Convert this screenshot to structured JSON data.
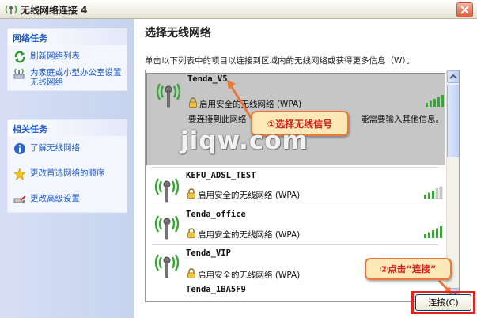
{
  "window": {
    "title": "无线网络连接 4"
  },
  "sidebar": {
    "network_tasks": {
      "header": "网络任务",
      "items": [
        {
          "label": "刷新网络列表",
          "icon": "refresh-icon"
        },
        {
          "label": "为家庭或小型办公室设置无线网络",
          "icon": "setup-network-icon"
        }
      ]
    },
    "related_tasks": {
      "header": "相关任务",
      "items": [
        {
          "label": "了解无线网络",
          "icon": "info-icon"
        },
        {
          "label": "更改首选网络的顺序",
          "icon": "star-icon"
        },
        {
          "label": "更改高级设置",
          "icon": "advanced-settings-icon"
        }
      ]
    }
  },
  "main": {
    "title": "选择无线网络",
    "description": "单击以下列表中的项目以连接到区域内的无线网络或获得更多信息（W）。",
    "networks": [
      {
        "name": "Tenda_V5",
        "security": "启用安全的无线网络 (WPA)",
        "detail_line1": "要连接到此网络",
        "detail_line2": "能需要输入其他信息。",
        "selected": true,
        "signal_bars": 5
      },
      {
        "name": "KEFU_ADSL_TEST",
        "security": "启用安全的无线网络 (WPA)",
        "signal_bars": 3
      },
      {
        "name": "Tenda_office",
        "security": "启用安全的无线网络 (WPA)",
        "signal_bars": 5
      },
      {
        "name": "Tenda_VIP",
        "security": "启用安全的无线网络 (WPA)",
        "signal_bars": 5
      },
      {
        "name": "Tenda_1BA5F9",
        "security": "",
        "signal_bars": 0
      }
    ],
    "connect_button": "连接(C)"
  },
  "annotations": {
    "step1": "①选择无线信号",
    "step2": "②点击“连接”",
    "watermark": "jiqw.com"
  },
  "colors": {
    "accent": "#215dc6",
    "callout_text": "#d4221c",
    "callout_border": "#e9783a",
    "highlight": "#e0231c",
    "selected_bg": "#c6c6c6",
    "signal_green": "#3aa536"
  }
}
